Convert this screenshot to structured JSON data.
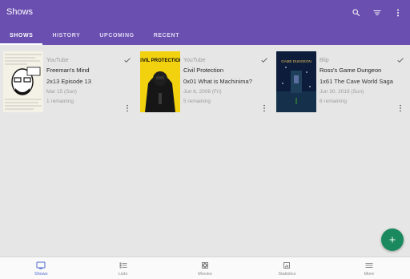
{
  "app": {
    "title": "Shows"
  },
  "toolbar": {
    "icons": [
      "search-icon",
      "filter-icon",
      "overflow-menu-icon"
    ]
  },
  "tabs": [
    {
      "label": "SHOWS",
      "active": true
    },
    {
      "label": "HISTORY",
      "active": false
    },
    {
      "label": "UPCOMING",
      "active": false
    },
    {
      "label": "RECENT",
      "active": false
    }
  ],
  "shows": [
    {
      "network": "YouTube",
      "title": "Freeman's Mind",
      "episode": "2x13 Episode 13",
      "date": "Mar 15 (Sun)",
      "remaining": "1 remaining",
      "poster_text": "FREEMAN'S MIND"
    },
    {
      "network": "YouTube",
      "title": "Civil Protection",
      "episode": "0x01 What is Machinima?",
      "date": "Jun 6, 2008 (Fri)",
      "remaining": "5 remaining",
      "poster_text": "CIVIL PROTECTION"
    },
    {
      "network": "Blip",
      "title": "Ross's Game Dungeon",
      "episode": "1x61 The Cave World Saga",
      "date": "Jun 30, 2019 (Sun)",
      "remaining": "6 remaining",
      "poster_text": "GAME DUNGEON"
    }
  ],
  "fab": {
    "icon": "plus-icon"
  },
  "bottom_nav": [
    {
      "label": "Shows",
      "icon": "tv-icon",
      "active": true
    },
    {
      "label": "Lists",
      "icon": "list-icon",
      "active": false
    },
    {
      "label": "Movies",
      "icon": "film-icon",
      "active": false
    },
    {
      "label": "Statistics",
      "icon": "chart-icon",
      "active": false
    },
    {
      "label": "More",
      "icon": "menu-icon",
      "active": false
    }
  ],
  "colors": {
    "primary": "#6a4fb0",
    "fab": "#1a8a5e",
    "nav_active": "#4f6bd0"
  }
}
